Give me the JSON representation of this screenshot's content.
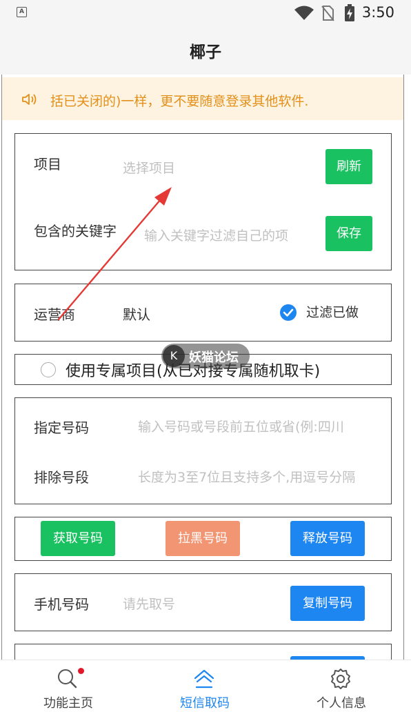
{
  "status_bar": {
    "time": "3:50",
    "notification_letter": "A"
  },
  "app": {
    "title": "椰子"
  },
  "notice": {
    "icon": "speaker-icon",
    "text": "括已关闭的)一样，更不要随意登录其他软件.",
    "color": "#e3901a"
  },
  "project_card": {
    "project_label": "项目",
    "project_placeholder": "选择项目",
    "refresh_label": "刷新",
    "keyword_label": "包含的关键字",
    "keyword_placeholder": "输入关键字过滤自己的项",
    "save_label": "保存"
  },
  "carrier_card": {
    "carrier_label": "运营商",
    "carrier_value": "默认",
    "filter_label": "过滤已做",
    "filter_checked": true
  },
  "exclusive": {
    "label": "使用专属项目(从已对接专属随机取卡)",
    "checked": false
  },
  "number_card": {
    "specified_label": "指定号码",
    "specified_placeholder": "输入号码或号段前五位或省(例:四川",
    "exclude_label": "排除号段",
    "exclude_placeholder": "长度为3至7位且支持多个,用逗号分隔"
  },
  "actions": {
    "get_label": "获取号码",
    "blacklist_label": "拉黑号码",
    "release_label": "释放号码"
  },
  "phone_card": {
    "phone_label": "手机号码",
    "phone_placeholder": "请先取号",
    "copy_label": "复制号码"
  },
  "watermark": {
    "text": "妖猫论坛",
    "logo_glyph": "K"
  },
  "bottom_nav": [
    {
      "label": "功能主页",
      "icon": "search-icon",
      "active": false,
      "badge": true
    },
    {
      "label": "短信取码",
      "icon": "home-icon",
      "active": true,
      "badge": false
    },
    {
      "label": "个人信息",
      "icon": "gear-icon",
      "active": false,
      "badge": false
    }
  ],
  "colors": {
    "green": "#19c160",
    "orange": "#f19572",
    "blue": "#1e86f0",
    "notice_bg": "#fdf3e0",
    "arrow": "#e53935"
  }
}
